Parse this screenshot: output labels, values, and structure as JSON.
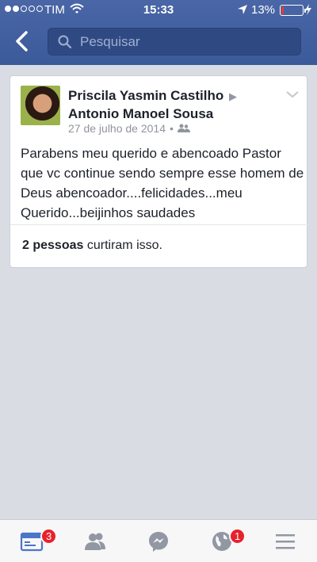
{
  "status": {
    "carrier": "TIM",
    "time": "15:33",
    "battery": "13%",
    "battery_level": 0.13
  },
  "nav": {
    "search_placeholder": "Pesquisar",
    "accent": "#3b5998"
  },
  "post": {
    "author": "Priscila Yasmin Castilho",
    "recipient": "Antonio Manoel Sousa",
    "date": "27 de julho de 2014",
    "separator": "•",
    "text": "Parabens meu querido e abencoado Pastor que vc continue sendo sempre esse homem de Deus abencoador....felicidades...meu Querido...beijinhos saudades",
    "likes_count": "2 pessoas",
    "likes_suffix": " curtiram isso."
  },
  "tabs": [
    {
      "name": "news-feed",
      "icon": "news-feed-icon",
      "badge": "3"
    },
    {
      "name": "friend-requests",
      "icon": "friends-icon",
      "badge": ""
    },
    {
      "name": "messenger",
      "icon": "messenger-icon",
      "badge": ""
    },
    {
      "name": "notifications",
      "icon": "globe-icon",
      "badge": "1"
    },
    {
      "name": "more",
      "icon": "menu-icon",
      "badge": ""
    }
  ]
}
